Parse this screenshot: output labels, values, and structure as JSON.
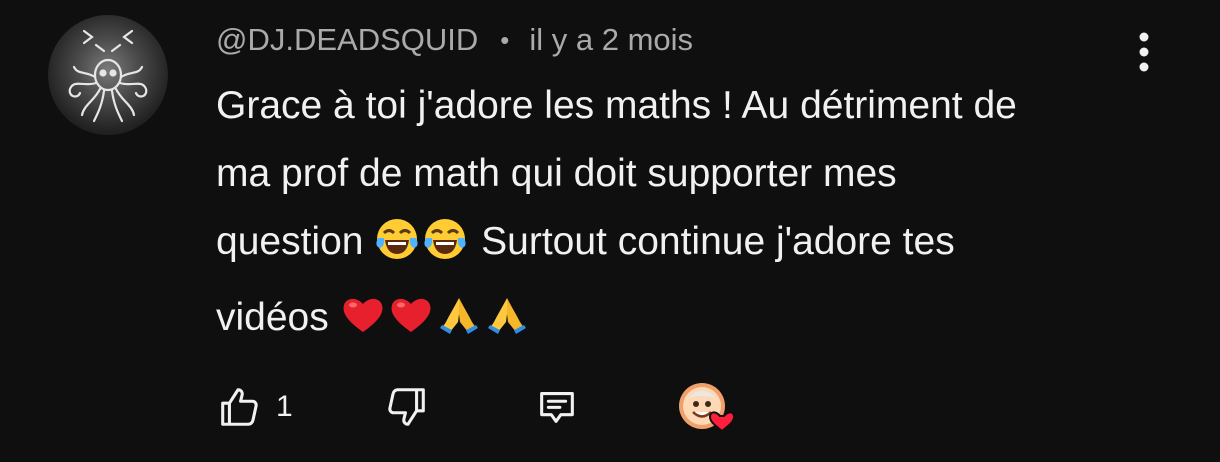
{
  "comment": {
    "author": "@DJ.DEADSQUID",
    "separator": "•",
    "timestamp": "il y a 2 mois",
    "text_line1": "Grace à toi j'adore les maths ! Au détriment de",
    "text_line2": "ma prof de math qui doit supporter mes",
    "text_line3_start": "question ",
    "text_line3_end": " Surtout continue j'adore tes",
    "text_line4": "vidéos ",
    "emojis": [
      "face-with-tears-of-joy",
      "face-with-tears-of-joy",
      "red-heart",
      "red-heart",
      "folded-hands",
      "folded-hands"
    ]
  },
  "actions": {
    "like_count": "1",
    "icons": [
      "thumbs-up-icon",
      "thumbs-down-icon",
      "reply-icon",
      "creator-heart-icon"
    ]
  },
  "colors": {
    "background": "#0f0f0f",
    "text": "#f1f1f1",
    "meta": "#aaaaaa",
    "heart": "#ff1f3d"
  }
}
